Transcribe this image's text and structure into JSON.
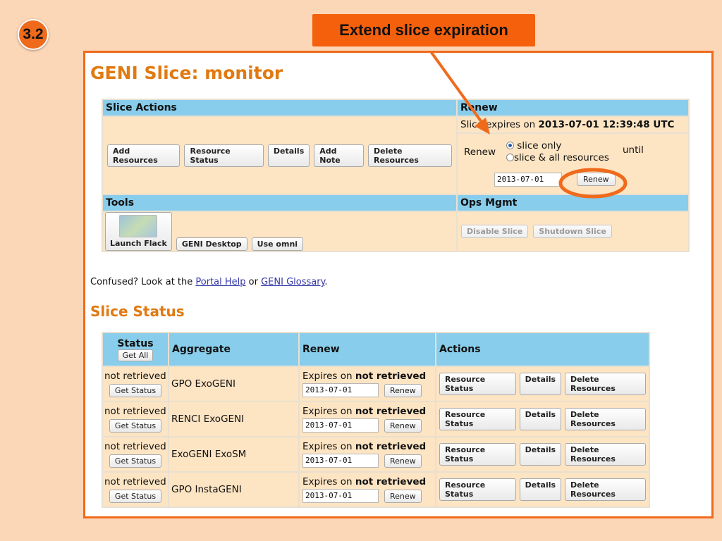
{
  "slide": {
    "step_number": "3.2",
    "callout_text": "Extend slice expiration"
  },
  "page": {
    "title": "GENI Slice: monitor"
  },
  "slice_actions": {
    "header": "Slice Actions",
    "buttons": [
      "Add Resources",
      "Resource Status",
      "Details",
      "Add Note",
      "Delete Resources"
    ]
  },
  "renew": {
    "header": "Renew",
    "expires_prefix": "Slice expires on ",
    "expires_value": "2013-07-01 12:39:48 UTC",
    "renew_label": "Renew",
    "options": [
      "slice only",
      "slice & all resources"
    ],
    "selected_option": "slice only",
    "until_label": "until",
    "date_value": "2013-07-01",
    "renew_button": "Renew"
  },
  "tools": {
    "header": "Tools",
    "buttons": [
      "Launch Flack",
      "GENI Desktop",
      "Use omni"
    ]
  },
  "ops_mgmt": {
    "header": "Ops Mgmt",
    "buttons": [
      "Disable Slice",
      "Shutdown Slice"
    ]
  },
  "help_line": {
    "prefix": "Confused? Look at the ",
    "link1": "Portal Help",
    "middle": " or ",
    "link2": "GENI Glossary",
    "suffix": "."
  },
  "slice_status": {
    "title": "Slice Status",
    "columns": {
      "status": "Status",
      "get_all": "Get All",
      "aggregate": "Aggregate",
      "renew": "Renew",
      "actions": "Actions"
    },
    "rows": [
      {
        "status": "not retrieved",
        "get_status": "Get Status",
        "aggregate": "GPO ExoGENI",
        "expires_prefix": "Expires on ",
        "expires_value": "not retrieved",
        "date": "2013-07-01",
        "renew_button": "Renew",
        "actions": [
          "Resource Status",
          "Details",
          "Delete Resources"
        ]
      },
      {
        "status": "not retrieved",
        "get_status": "Get Status",
        "aggregate": "RENCI ExoGENI",
        "expires_prefix": "Expires on ",
        "expires_value": "not retrieved",
        "date": "2013-07-01",
        "renew_button": "Renew",
        "actions": [
          "Resource Status",
          "Details",
          "Delete Resources"
        ]
      },
      {
        "status": "not retrieved",
        "get_status": "Get Status",
        "aggregate": "ExoGENI ExoSM",
        "expires_prefix": "Expires on ",
        "expires_value": "not retrieved",
        "date": "2013-07-01",
        "renew_button": "Renew",
        "actions": [
          "Resource Status",
          "Details",
          "Delete Resources"
        ]
      },
      {
        "status": "not retrieved",
        "get_status": "Get Status",
        "aggregate": "GPO InstaGENI",
        "expires_prefix": "Expires on ",
        "expires_value": "not retrieved",
        "date": "2013-07-01",
        "renew_button": "Renew",
        "actions": [
          "Resource Status",
          "Details",
          "Delete Resources"
        ]
      }
    ]
  },
  "colors": {
    "accent_orange": "#f06a1c",
    "header_blue": "#88cdeb",
    "cell_peach": "#fde4c3",
    "title_orange": "#e07a12",
    "slide_background": "#fbd7b7"
  }
}
